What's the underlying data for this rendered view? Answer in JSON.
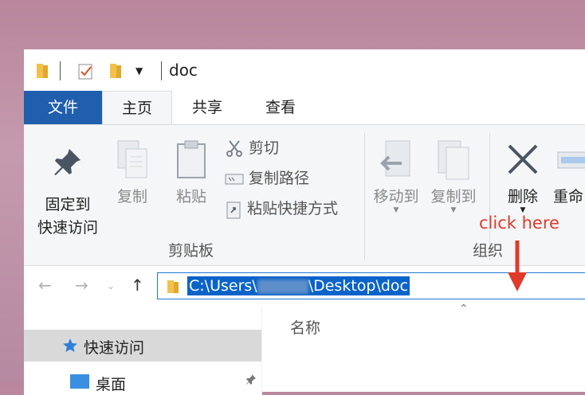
{
  "window": {
    "title": "doc"
  },
  "tabs": {
    "file": "文件",
    "home": "主页",
    "share": "共享",
    "view": "查看"
  },
  "ribbon": {
    "pin_line1": "固定到",
    "pin_line2": "快速访问",
    "copy": "复制",
    "paste": "粘贴",
    "cut": "剪切",
    "copy_path": "复制路径",
    "paste_shortcut": "粘贴快捷方式",
    "clipboard_group": "剪贴板",
    "move_to": "移动到",
    "copy_to": "复制到",
    "delete": "删除",
    "rename": "重命",
    "organize_group": "组织"
  },
  "annotation": {
    "text": "click here",
    "color": "#e03a2a"
  },
  "address_bar": {
    "path_prefix": "C:\\Users\\",
    "path_suffix": "\\Desktop\\doc"
  },
  "nav_pane": {
    "quick_access": "快速访问",
    "desktop": "桌面"
  },
  "file_list": {
    "name_column": "名称"
  },
  "colors": {
    "accent": "#1f5fad",
    "selection": "#0a63c9"
  }
}
